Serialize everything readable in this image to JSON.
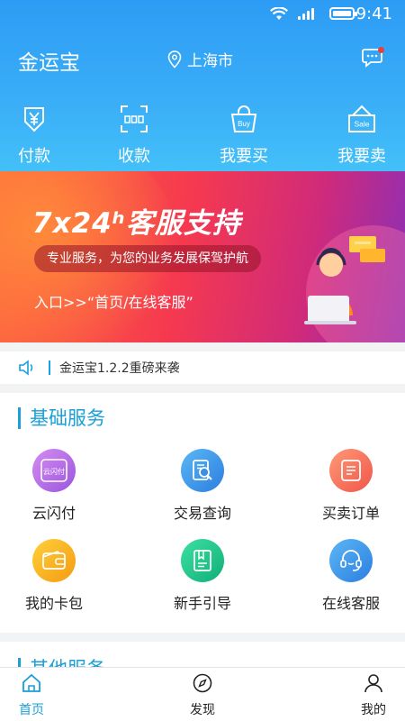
{
  "status_bar": {
    "time": "9:41"
  },
  "header": {
    "app_title": "金运宝",
    "location": "上海市",
    "message_badge": "1"
  },
  "quick_actions": [
    {
      "label": "付款",
      "icon": "yen-scan-icon"
    },
    {
      "label": "收款",
      "icon": "qr-frame-icon"
    },
    {
      "label": "我要买",
      "icon": "shopping-bag-icon",
      "icon_text": "Buy"
    },
    {
      "label": "我要卖",
      "icon": "sale-box-icon",
      "icon_text": "Sale"
    }
  ],
  "banner": {
    "title": "7x24ʰ客服支持",
    "subtitle": "专业服务，为您的业务发展保驾护航",
    "entry": "入口>>“首页/在线客服”"
  },
  "notice": {
    "text": "金运宝1.2.2重磅来袭"
  },
  "basic_services": {
    "title": "基础服务",
    "items": [
      {
        "label": "云闪付",
        "icon": "cloud-pay-icon",
        "icon_text": "云闪付",
        "color": "#b76de6"
      },
      {
        "label": "交易查询",
        "icon": "search-document-icon",
        "color": "#2f8fe6"
      },
      {
        "label": "买卖订单",
        "icon": "order-list-icon",
        "color": "#f5705a"
      },
      {
        "label": "我的卡包",
        "icon": "wallet-icon",
        "color": "#f7b21a"
      },
      {
        "label": "新手引导",
        "icon": "guide-book-icon",
        "color": "#1cc08a"
      },
      {
        "label": "在线客服",
        "icon": "headset-icon",
        "color": "#2f8fe6"
      }
    ]
  },
  "other_services": {
    "title": "其他服务"
  },
  "tabbar": [
    {
      "label": "首页",
      "icon": "home-icon",
      "active": true
    },
    {
      "label": "发现",
      "icon": "compass-icon",
      "active": false
    },
    {
      "label": "我的",
      "icon": "user-icon",
      "active": false
    }
  ]
}
